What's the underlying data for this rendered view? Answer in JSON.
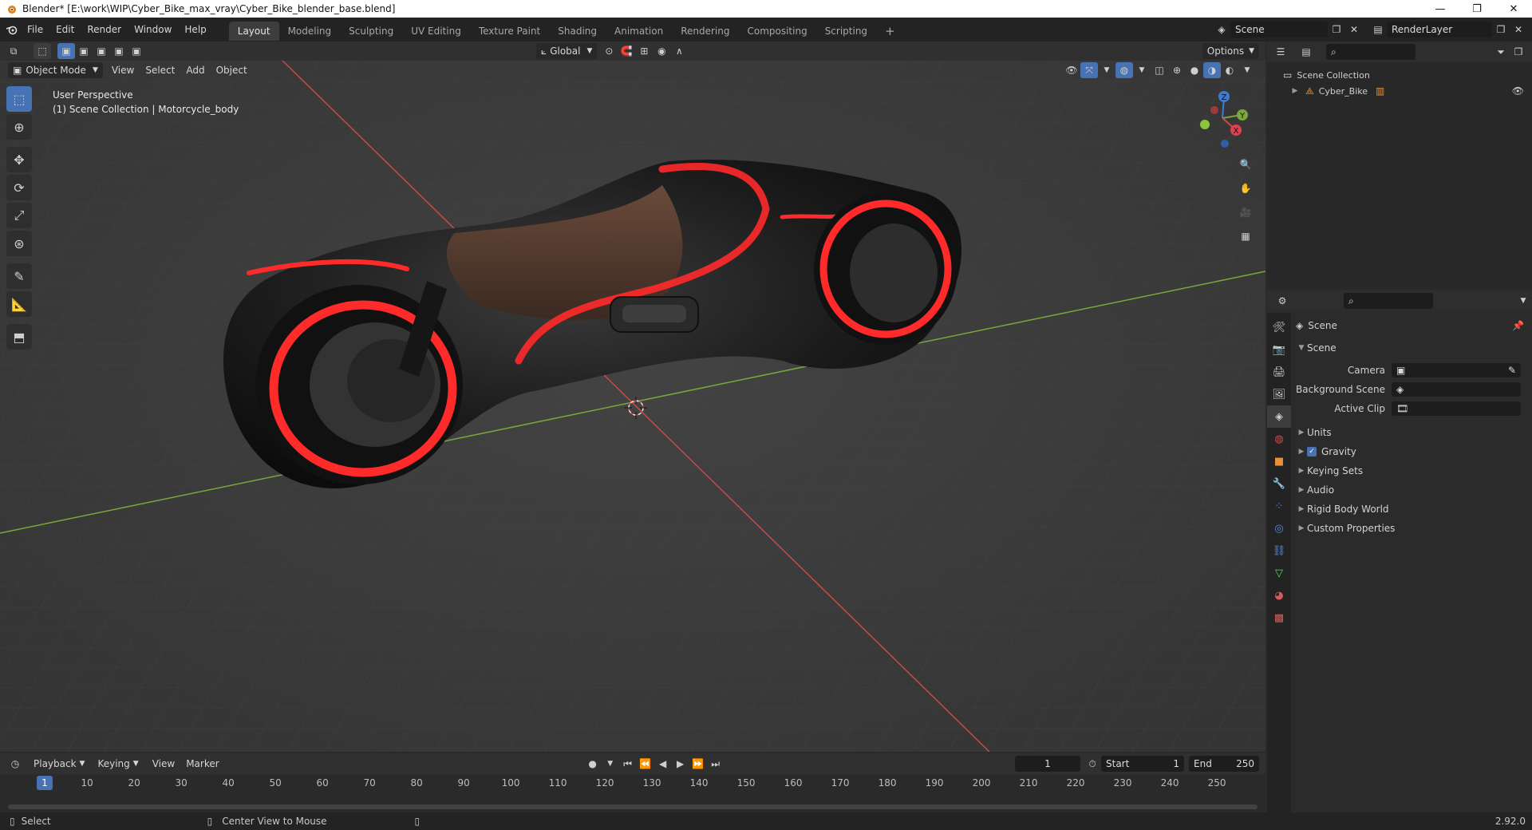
{
  "window": {
    "title": "Blender* [E:\\work\\WIP\\Cyber_Bike_max_vray\\Cyber_Bike_blender_base.blend]",
    "minimize": "—",
    "maximize": "❐",
    "close": "✕"
  },
  "menubar": {
    "items": [
      "File",
      "Edit",
      "Render",
      "Window",
      "Help"
    ],
    "workspaces": [
      "Layout",
      "Modeling",
      "Sculpting",
      "UV Editing",
      "Texture Paint",
      "Shading",
      "Animation",
      "Rendering",
      "Compositing",
      "Scripting"
    ],
    "active_workspace": "Layout",
    "add_workspace": "+",
    "scene_name": "Scene",
    "render_layer": "RenderLayer"
  },
  "viewport": {
    "mode": "Object Mode",
    "menus": [
      "View",
      "Select",
      "Add",
      "Object"
    ],
    "transform_orientation": "Global",
    "options": "Options",
    "info_line1": "User Perspective",
    "info_line2": "(1) Scene Collection | Motorcycle_body",
    "gizmo": {
      "x": "X",
      "y": "Y",
      "z": "Z"
    }
  },
  "outliner": {
    "root": "Scene Collection",
    "items": [
      {
        "label": "Cyber_Bike"
      }
    ]
  },
  "properties": {
    "header": "Scene",
    "section_scene": "Scene",
    "fields": [
      {
        "label": "Camera",
        "value": ""
      },
      {
        "label": "Background Scene",
        "value": ""
      },
      {
        "label": "Active Clip",
        "value": ""
      }
    ],
    "sections": [
      "Units",
      "Gravity",
      "Keying Sets",
      "Audio",
      "Rigid Body World",
      "Custom Properties"
    ],
    "gravity_checked": true
  },
  "timeline": {
    "menus": [
      "Playback",
      "Keying",
      "View",
      "Marker"
    ],
    "current_frame": "1",
    "start_label": "Start",
    "start_value": "1",
    "end_label": "End",
    "end_value": "250",
    "ticks": [
      "1",
      "10",
      "20",
      "30",
      "40",
      "50",
      "60",
      "70",
      "80",
      "90",
      "100",
      "110",
      "120",
      "130",
      "140",
      "150",
      "160",
      "170",
      "180",
      "190",
      "200",
      "210",
      "220",
      "230",
      "240",
      "250"
    ]
  },
  "statusbar": {
    "left": "Select",
    "middle": "Center View to Mouse",
    "version": "2.92.0"
  },
  "colors": {
    "accent": "#4772b3",
    "neon": "#ff2a2a",
    "axis_x": "#c84a4a",
    "axis_y": "#7aa83a",
    "axis_z": "#3b7cd8"
  }
}
